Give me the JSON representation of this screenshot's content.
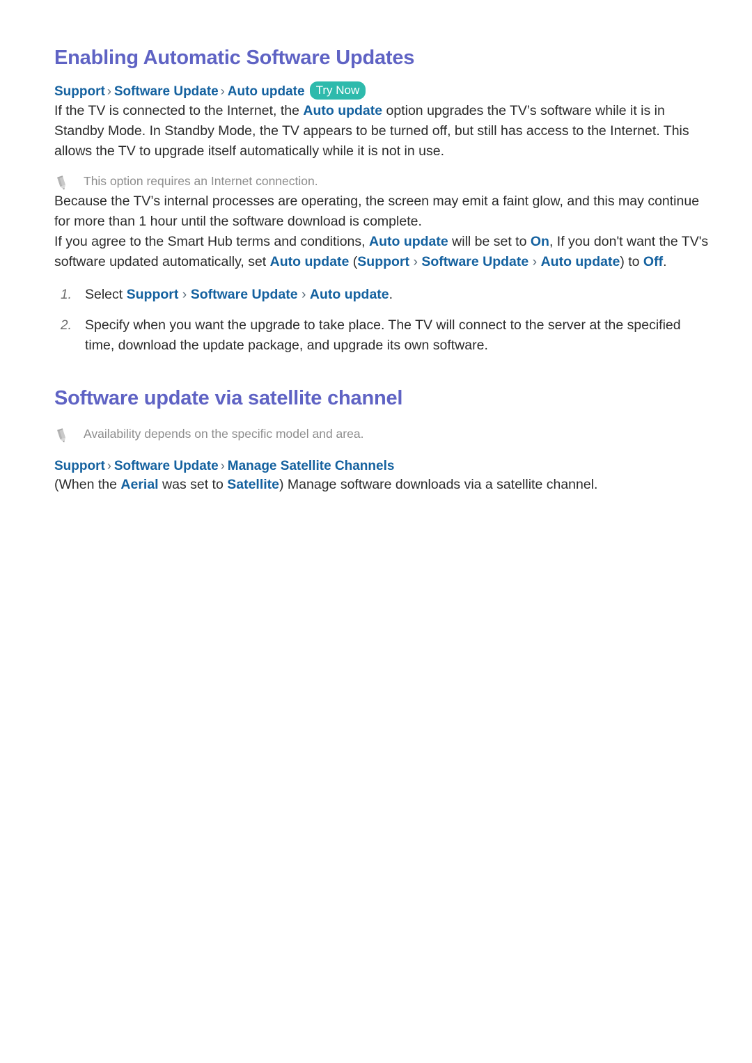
{
  "theme": {
    "background": "#ffffff",
    "heading_color": "#5f63c4",
    "link_color": "#14619f",
    "body_color": "#2b2b2b",
    "note_color": "#8d8d8d",
    "badge_color": "#2ebaac",
    "badge_text_color": "#ffffff",
    "separator_color": "#5a6b78"
  },
  "sections": {
    "software_updates": {
      "heading": "Enabling Automatic Software Updates",
      "breadcrumb": {
        "crumbs": [
          "Support",
          "Software Update",
          "Auto update"
        ],
        "separator": "›",
        "badge": "Try Now"
      },
      "paragraph_1": {
        "part_1": "If the TV is connected to the Internet, the ",
        "link_1": "Auto update",
        "part_2": " option upgrades the TV’s software while it is in Standby Mode. In Standby Mode, the TV appears to be turned off, but still has access to the Internet. This allows the TV to upgrade itself automatically while it is not in use."
      },
      "note_1": {
        "icon": "pencil-icon",
        "text": "This option requires an Internet connection."
      },
      "paragraph_2": "Because the TV’s internal processes are operating, the screen may emit a faint glow, and this may continue for more than 1 hour until the software download is complete.",
      "paragraph_3": {
        "part_1": "If you agree to the Smart Hub terms and conditions, ",
        "link_1": "Auto update",
        "part_2": " will be set to ",
        "link_2": "On",
        "part_3": ", If you don't want the TV's software updated automatically, set ",
        "link_3": "Auto update",
        "part_4": " (",
        "link_4": "Support",
        "sep_1": "›",
        "link_5": "Software Update",
        "sep_2": "›",
        "link_6": "Auto update",
        "part_5": ") to ",
        "link_7": "Off",
        "part_6": "."
      },
      "steps": [
        {
          "number": "1.",
          "prefix": "Select ",
          "crumbs": [
            "Support",
            "Software Update",
            "Auto update"
          ],
          "separator": "›",
          "suffix": "."
        },
        {
          "number": "2.",
          "text": "Specify when you want the upgrade to take place. The TV will connect to the server at the specified time, download the update package, and upgrade its own software."
        }
      ]
    },
    "satellite_update": {
      "heading": "Software update via satellite channel",
      "note_1": {
        "icon": "pencil-icon",
        "text": "Availability depends on the specific model and area."
      },
      "breadcrumb": {
        "crumbs": [
          "Support",
          "Software Update",
          "Manage Satellite Channels"
        ],
        "separator": "›"
      },
      "paragraph_1": {
        "part_1": "(When the ",
        "link_1": "Aerial",
        "part_2": " was set to ",
        "link_2": "Satellite",
        "part_3": ") Manage software downloads via a satellite channel."
      }
    }
  }
}
